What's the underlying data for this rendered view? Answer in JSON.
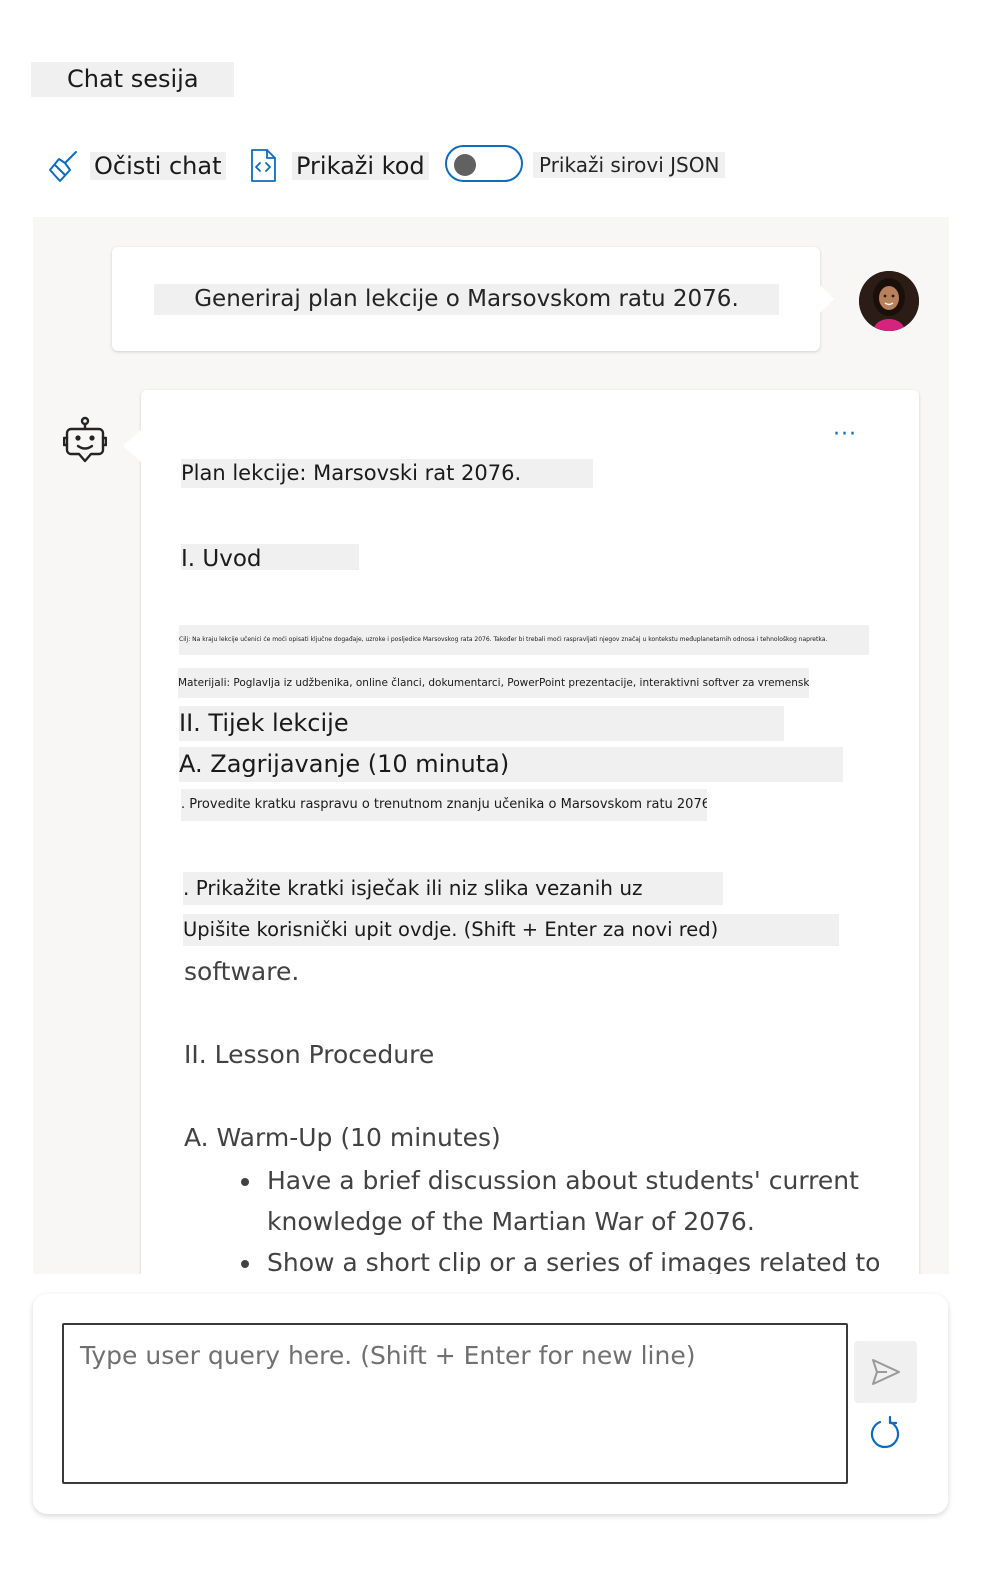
{
  "session": {
    "title": "Chat sesija"
  },
  "toolbar": {
    "clear_label": "Očisti chat",
    "code_label": "Prikaži kod",
    "raw_json_label": "Prikaži sirovi JSON",
    "raw_json_on": false
  },
  "user_message": {
    "text": "Generiraj plan lekcije o Marsovskom ratu 2076."
  },
  "bot_message": {
    "more_label": "···",
    "lines": {
      "plan_title": "Plan lekcije: Marsovski rat 2076.",
      "intro": "I. Uvod",
      "goal": "Cilj: Na kraju lekcije učenici će moći opisati ključne događaje, uzroke i posljedice Marsovskog rata 2076. Također bi trebali moći raspravljati njegov značaj u kontekstu međuplanetarnih odnosa i tehnološkog napretka.",
      "materials": "Materijali: Poglavlja iz udžbenika, online članci, dokumentarci, PowerPoint prezentacije, interaktivni softver za vremensku crtu.",
      "procedure": "II. Tijek lekcije",
      "warmup": "A. Zagrijavanje (10 minuta)",
      "warmup_item1": ". Provedite kratku raspravu o trenutnom znanju učenika o Marsovskom ratu 2076.",
      "warmup_item2": ". Prikažite kratki isječak ili niz slika vezanih uz",
      "overlay_input": "Upišite korisnički upit ovdje. (Shift + Enter za novi red)",
      "software": "software.",
      "lesson_procedure": "II. Lesson Procedure",
      "warm_up": "A. Warm-Up (10 minutes)"
    },
    "bullets": [
      "Have a brief discussion about students' current knowledge of the Martian War of 2076.",
      "Show a short clip or a series of images related to"
    ]
  },
  "input": {
    "placeholder": "Type user query here. (Shift + Enter for new line)",
    "send_icon": "send-icon",
    "refresh_icon": "refresh-icon"
  },
  "colors": {
    "accent": "#0f6cbd",
    "pane_bg": "#f8f7f6",
    "highlight": "#f0f0f0"
  }
}
